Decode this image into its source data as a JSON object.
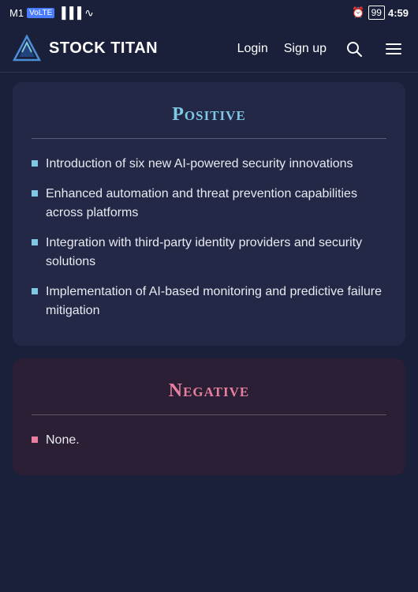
{
  "statusBar": {
    "carrier": "M1",
    "network": "VoLTE",
    "signal": "signal",
    "wifi": "wifi",
    "alarm": "alarm",
    "battery": "99",
    "time": "4:59"
  },
  "navbar": {
    "brandName": "STOCK TITAN",
    "loginLabel": "Login",
    "signupLabel": "Sign up"
  },
  "positiveSection": {
    "title": "Positive",
    "bullets": [
      "Introduction of six new AI-powered security innovations",
      "Enhanced automation and threat prevention capabilities across platforms",
      "Integration with third-party identity providers and security solutions",
      "Implementation of AI-based monitoring and predictive failure mitigation"
    ]
  },
  "negativeSection": {
    "title": "Negative",
    "bullets": [
      "None."
    ]
  }
}
